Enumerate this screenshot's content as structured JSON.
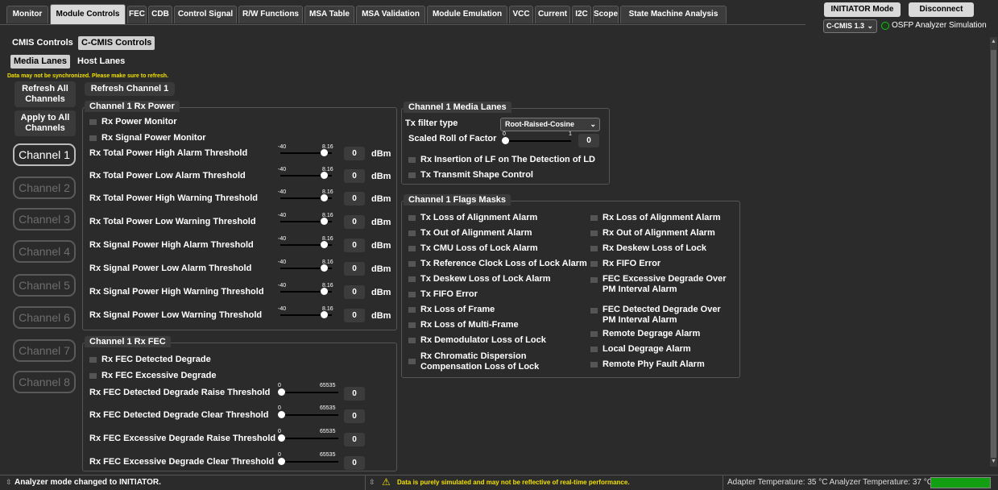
{
  "tabs": [
    "Monitor",
    "Module Controls",
    "FEC",
    "CDB",
    "Control Signal",
    "R/W Functions",
    "MSA Table",
    "MSA Validation",
    "Module Emulation",
    "VCC",
    "Current",
    "I2C",
    "Scope",
    "State Machine Analysis"
  ],
  "active_tab": "Module Controls",
  "top_right": {
    "mode_button": "INITIATOR Mode",
    "disconnect_button": "Disconnect",
    "cmis_select": "C-CMIS 1.3",
    "simulation_label": "OSFP Analyzer Simulation"
  },
  "control_tabs": [
    "CMIS Controls",
    "C-CMIS Controls"
  ],
  "lane_tabs": [
    "Media Lanes",
    "Host Lanes"
  ],
  "sync_warning": "Data may not be synchronized. Please make sure to refresh.",
  "buttons": {
    "refresh_all": "Refresh All Channels",
    "apply_all": "Apply to All Channels",
    "refresh_channel": "Refresh Channel 1"
  },
  "channels": [
    "Channel 1",
    "Channel 2",
    "Channel 3",
    "Channel 4",
    "Channel 5",
    "Channel 6",
    "Channel 7",
    "Channel 8"
  ],
  "rx_power": {
    "title": "Channel 1 Rx Power",
    "checkboxes": [
      "Rx Power Monitor",
      "Rx Signal Power Monitor"
    ],
    "slider_min": "-40",
    "slider_max": "8.16",
    "unit": "dBm",
    "rows": [
      {
        "label": "Rx Total Power High Alarm Threshold",
        "value": "0"
      },
      {
        "label": "Rx Total Power Low Alarm Threshold",
        "value": "0"
      },
      {
        "label": "Rx Total Power High Warning Threshold",
        "value": "0"
      },
      {
        "label": "Rx Total Power Low Warning Threshold",
        "value": "0"
      },
      {
        "label": "Rx Signal Power High Alarm Threshold",
        "value": "0"
      },
      {
        "label": "Rx Signal Power Low Alarm Threshold",
        "value": "0"
      },
      {
        "label": "Rx Signal Power High Warning Threshold",
        "value": "0"
      },
      {
        "label": "Rx Signal Power Low Warning Threshold",
        "value": "0"
      }
    ]
  },
  "rx_fec": {
    "title": "Channel 1 Rx FEC",
    "checkboxes": [
      "Rx FEC Detected Degrade",
      "Rx FEC Excessive Degrade"
    ],
    "slider_min": "0",
    "slider_max": "65535",
    "rows": [
      {
        "label": "Rx FEC Detected Degrade Raise Threshold",
        "value": "0"
      },
      {
        "label": "Rx FEC Detected Degrade Clear Threshold",
        "value": "0"
      },
      {
        "label": "Rx FEC Excessive Degrade Raise Threshold",
        "value": "0"
      },
      {
        "label": "Rx FEC Excessive Degrade Clear Threshold",
        "value": "0"
      }
    ]
  },
  "media_lanes": {
    "title": "Channel 1 Media Lanes",
    "tx_filter_label": "Tx filter type",
    "tx_filter_value": "Root-Raised-Cosine",
    "rolloff_label": "Scaled Roll of Factor",
    "rolloff_min": "0",
    "rolloff_max": "1",
    "rolloff_value": "0",
    "checkboxes": [
      "Rx Insertion of LF on The Detection of LD",
      "Tx Transmit Shape Control"
    ]
  },
  "flags": {
    "title": "Channel 1 Flags Masks",
    "left": [
      "Tx Loss of Alignment Alarm",
      "Tx Out of Alignment Alarm",
      "Tx CMU Loss of Lock Alarm",
      "Tx Reference Clock Loss of Lock Alarm",
      "Tx Deskew Loss of Lock Alarm",
      "Tx FIFO Error",
      "Rx Loss of Frame",
      "Rx Loss of Multi-Frame",
      "Rx Demodulator Loss of Lock",
      "Rx Chromatic Dispersion Compensation Loss of Lock"
    ],
    "right": [
      "Rx Loss of Alignment Alarm",
      "Rx Out of Alignment Alarm",
      "Rx Deskew Loss of Lock",
      "Rx FIFO Error",
      "FEC Excessive Degrade Over PM Interval Alarm",
      "FEC Detected Degrade Over PM Interval Alarm",
      "Remote Degrage Alarm",
      "Local Degrage Alarm",
      "Remote Phy Fault Alarm"
    ]
  },
  "status": {
    "left": "Analyzer mode changed to INITIATOR.",
    "middle": "Data is purely simulated and may not be reflective of real-time performance.",
    "right": "Adapter Temperature: 35 °C  Analyzer Temperature: 37 °C"
  },
  "colors": {
    "warning": "#f0e000",
    "status_ok": "#12a012",
    "sim_dot": "#22bb22"
  }
}
